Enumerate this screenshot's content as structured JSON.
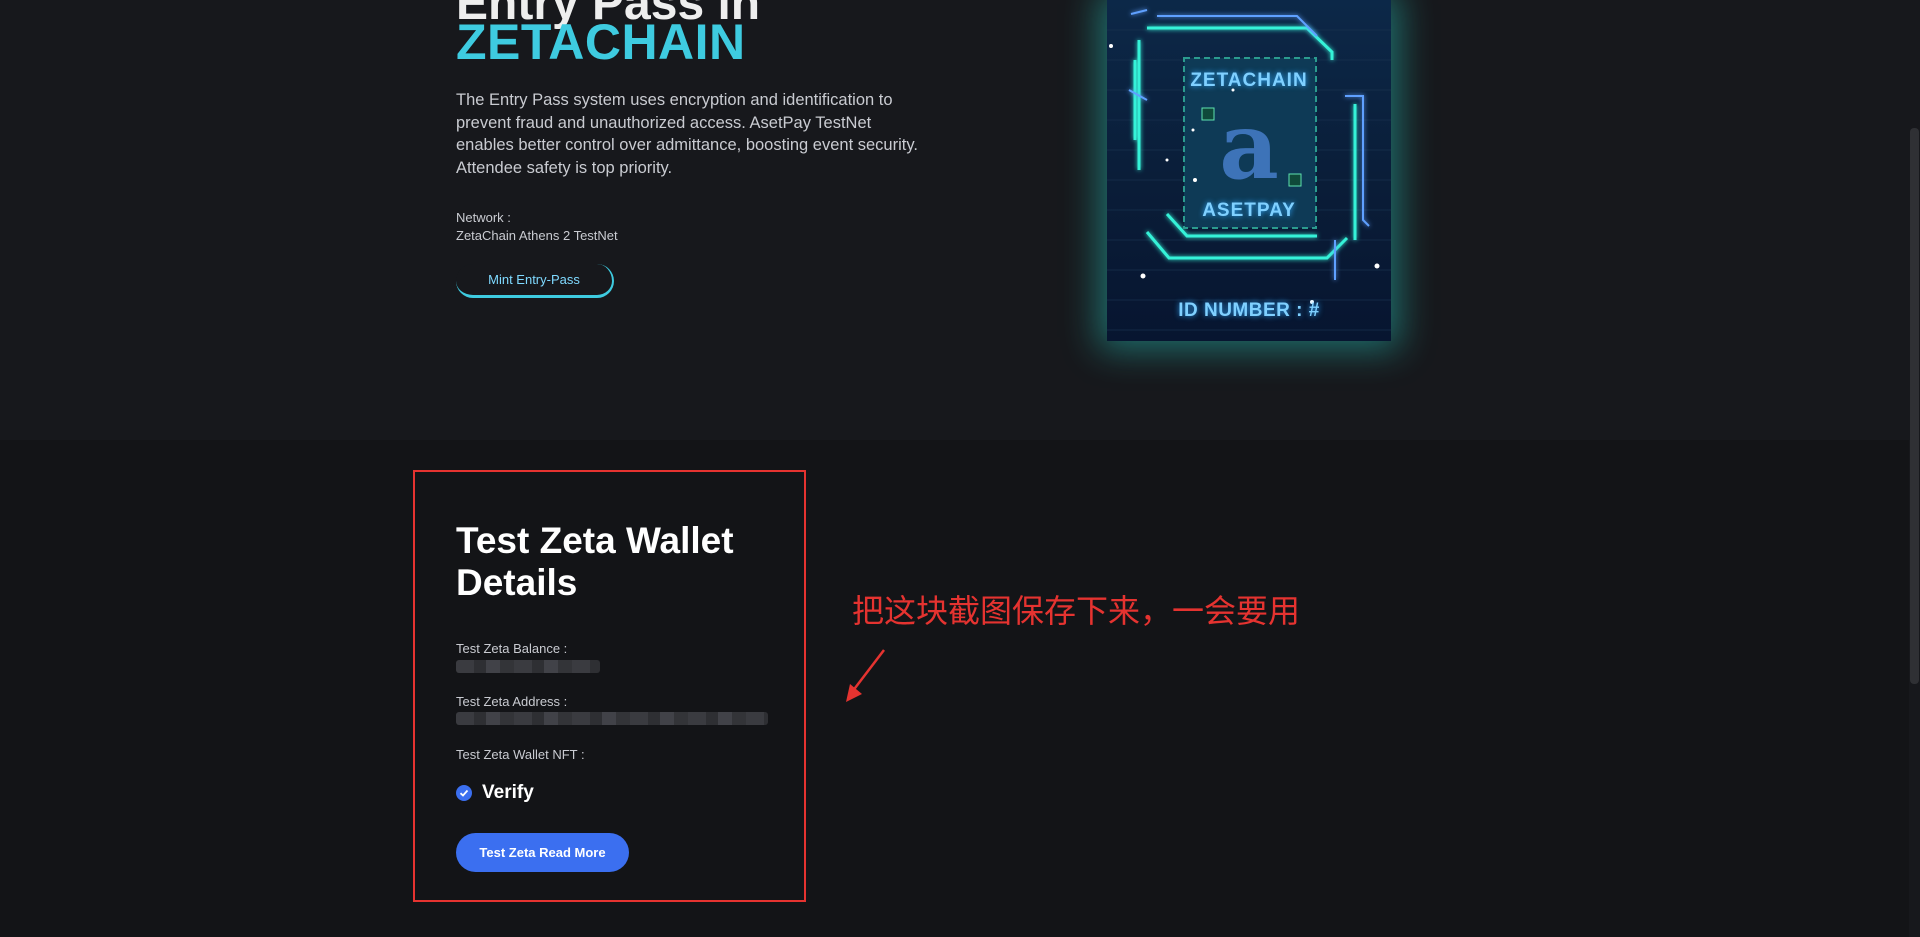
{
  "hero": {
    "heading": "Entry Pass in",
    "title": "ZETACHAIN",
    "description": "The Entry Pass system uses encryption and identification to prevent fraud and unauthorized access. AsetPay TestNet enables better control over admittance, boosting event security. Attendee safety is top priority.",
    "network_label": "Network :",
    "network_value": "ZetaChain Athens 2 TestNet",
    "mint_button": "Mint Entry-Pass"
  },
  "nft_card": {
    "brand_top": "ZETACHAIN",
    "logo_letter": "a",
    "brand_bottom": "ASETPAY",
    "id_number": "ID NUMBER : #",
    "colors": {
      "glow": "#2fe0d0",
      "brand_text": "#7fd0ff",
      "logo": "#3d73b8"
    }
  },
  "wallet": {
    "title": "Test Zeta Wallet Details",
    "balance_label": "Test Zeta Balance :",
    "address_label": "Test Zeta Address :",
    "nft_label": "Test Zeta Wallet NFT :",
    "verify_label": "Verify",
    "read_more_button": "Test Zeta Read More"
  },
  "annotation": {
    "text": "把这块截图保存下来，一会要用",
    "color": "#e53330"
  },
  "colors": {
    "accent_cyan": "#3ecbe0",
    "button_blue": "#3b6ff0",
    "page_bg": "#131417",
    "highlight_red": "#e53330"
  },
  "icons": {
    "verify": "check-circle-icon",
    "annotation_arrow": "arrow-icon"
  }
}
